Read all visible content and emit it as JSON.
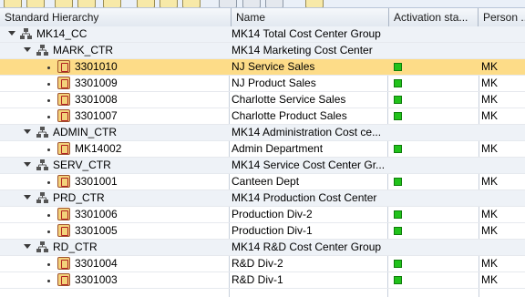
{
  "header": {
    "columns": [
      "Standard Hierarchy",
      "Name",
      "Activation sta...",
      "Person ..."
    ]
  },
  "rows": [
    {
      "id": "MK14_CC",
      "name": "MK14 Total Cost Center Group",
      "status": "",
      "person": ""
    },
    {
      "id": "MARK_CTR",
      "name": "MK14 Marketing Cost Center",
      "status": "",
      "person": ""
    },
    {
      "id": "3301010",
      "name": "NJ Service Sales",
      "status": "active",
      "person": "MK"
    },
    {
      "id": "3301009",
      "name": "NJ Product Sales",
      "status": "active",
      "person": "MK"
    },
    {
      "id": "3301008",
      "name": "Charlotte Service Sales",
      "status": "active",
      "person": "MK"
    },
    {
      "id": "3301007",
      "name": "Charlotte Product Sales",
      "status": "active",
      "person": "MK"
    },
    {
      "id": "ADMIN_CTR",
      "name": "MK14 Administration Cost ce...",
      "status": "",
      "person": ""
    },
    {
      "id": "MK14002",
      "name": "Admin Department",
      "status": "active",
      "person": "MK"
    },
    {
      "id": "SERV_CTR",
      "name": "MK14 Service Cost Center Gr...",
      "status": "",
      "person": ""
    },
    {
      "id": "3301001",
      "name": "Canteen Dept",
      "status": "active",
      "person": "MK"
    },
    {
      "id": "PRD_CTR",
      "name": "MK14 Production Cost Center",
      "status": "",
      "person": ""
    },
    {
      "id": "3301006",
      "name": "Production Div-2",
      "status": "active",
      "person": "MK"
    },
    {
      "id": "3301005",
      "name": "Production Div-1",
      "status": "active",
      "person": "MK"
    },
    {
      "id": "RD_CTR",
      "name": "MK14 R&D Cost Center Group",
      "status": "",
      "person": ""
    },
    {
      "id": "3301004",
      "name": "R&D Div-2",
      "status": "active",
      "person": "MK"
    },
    {
      "id": "3301003",
      "name": "R&D Div-1",
      "status": "active",
      "person": "MK"
    }
  ],
  "colors": {
    "selected": "#fddc88",
    "active_status": "#21c21b"
  },
  "icons": {
    "group": "hierarchy-node-icon",
    "leaf": "cost-center-icon",
    "expand": "expand-arrow-icon"
  }
}
